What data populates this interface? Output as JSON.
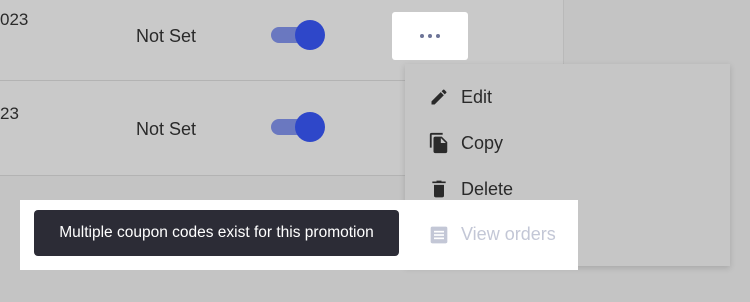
{
  "rows": [
    {
      "date_fragment": "023",
      "status": "Not Set",
      "active": true
    },
    {
      "date_fragment": "23",
      "status": "Not Set",
      "active": true
    }
  ],
  "actions_menu": {
    "items": [
      {
        "label": "Edit",
        "icon": "pencil-icon"
      },
      {
        "label": "Copy",
        "icon": "copy-icon"
      },
      {
        "label": "Delete",
        "icon": "trash-icon"
      },
      {
        "label": "View orders",
        "icon": "list-icon",
        "disabled": true
      }
    ]
  },
  "tooltip": {
    "text": "Multiple coupon codes exist for this promotion"
  },
  "colors": {
    "toggle_track": "#6a78c0",
    "toggle_knob": "#2e47c9",
    "tooltip_bg": "#2c2c36",
    "disabled_text": "#c3c7d6"
  }
}
